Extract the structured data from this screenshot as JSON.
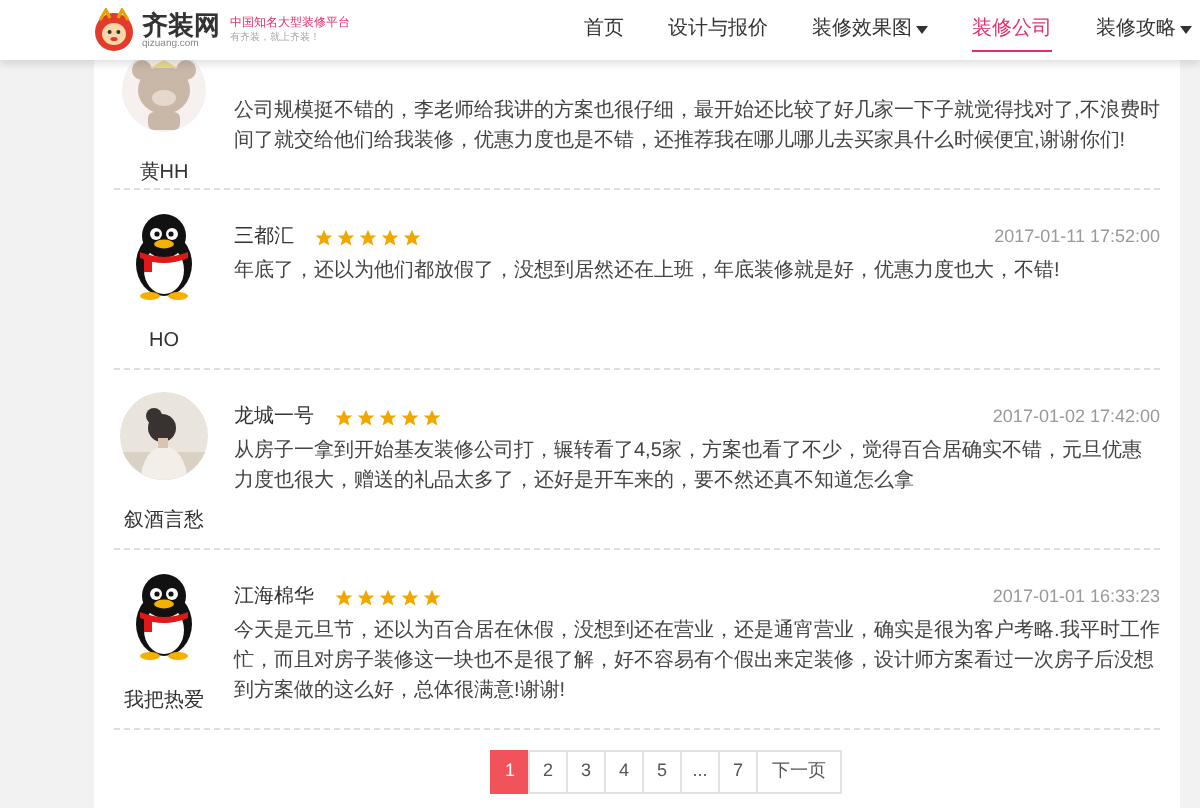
{
  "header": {
    "logo": {
      "name": "齐装网",
      "domain": "qizuang.com",
      "tagline": "中国知名大型装修平台",
      "slogan": "有齐装，就上齐装！"
    },
    "nav": [
      {
        "label": "首页",
        "selected": false,
        "dropdown": false
      },
      {
        "label": "设计与报价",
        "selected": false,
        "dropdown": false
      },
      {
        "label": "装修效果图",
        "selected": false,
        "dropdown": true
      },
      {
        "label": "装修公司",
        "selected": true,
        "dropdown": false
      },
      {
        "label": "装修攻略",
        "selected": false,
        "dropdown": true
      }
    ]
  },
  "reviews": [
    {
      "author": "黄HH",
      "avatar": {
        "kind": "bear"
      },
      "text": "公司规模挺不错的，李老师给我讲的方案也很仔细，最开始还比较了好几家一下子就觉得找对了,不浪费时间了就交给他们给我装修，优惠力度也是不错，还推荐我在哪儿哪儿去买家具什么时候便宜,谢谢你们!"
    },
    {
      "author": "HO",
      "avatar": {
        "kind": "penguin"
      },
      "name": "三都汇",
      "stars": 5,
      "date": "2017-01-11 17:52:00",
      "text": "年底了，还以为他们都放假了，没想到居然还在上班，年底装修就是好，优惠力度也大，不错!"
    },
    {
      "author": "叙酒言愁",
      "name": "龙城一号",
      "stars": 5,
      "date": "2017-01-02 17:42:00",
      "text": "从房子一拿到开始基友装修公司打，辗转看了4,5家，方案也看了不少，觉得百合居确实不错，元旦优惠力度也很大，赠送的礼品太多了，还好是开车来的，要不然还真不知道怎么拿"
    },
    {
      "author": "我把热爱",
      "avatar": {
        "kind": "penguin"
      },
      "name": "江海棉华",
      "stars": 5,
      "date": "2017-01-01 16:33:23",
      "text": "今天是元旦节，还以为百合居在休假，没想到还在营业，还是通宵营业，确实是很为客户考略.我平时工作忙，而且对房子装修这一块也不是很了解，好不容易有个假出来定装修，设计师方案看过一次房子后没想到方案做的这么好，总体很满意!谢谢!"
    }
  ],
  "pagination": {
    "pages": [
      {
        "label": "1",
        "selected": true
      },
      {
        "label": "2",
        "selected": false
      },
      {
        "label": "3",
        "selected": false
      },
      {
        "label": "4",
        "selected": false
      },
      {
        "label": "5",
        "selected": false
      },
      {
        "label": "...",
        "selected": false
      },
      {
        "label": "7",
        "selected": false
      }
    ],
    "next": "下一页"
  }
}
